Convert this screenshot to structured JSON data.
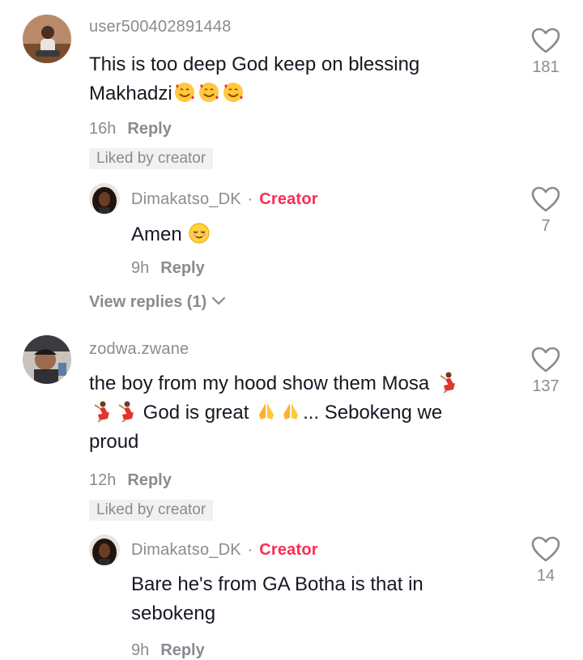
{
  "comments": [
    {
      "username": "user500402891448",
      "text_line1": "This is too deep God keep on blessing",
      "text_line2": "Makhadzi",
      "time": "16h",
      "reply_label": "Reply",
      "liked_label": "Liked by creator",
      "likes": "181",
      "emoji": "smiling-face-with-hearts"
    },
    {
      "username": "Dimakatso_DK",
      "creator_label": "Creator",
      "text": "Amen",
      "time": "9h",
      "reply_label": "Reply",
      "likes": "7",
      "emoji": "relieved-face"
    },
    {
      "view_replies": "View replies (1)"
    },
    {
      "username": "zodwa.zwane",
      "text_line1": "the boy from my hood show them Mosa",
      "text_line2": "God is great",
      "text_line2b": "... Sebokeng we",
      "text_line3": "proud",
      "time": "12h",
      "reply_label": "Reply",
      "liked_label": "Liked by creator",
      "likes": "137",
      "emoji": [
        "woman-dancing",
        "folded-hands"
      ]
    },
    {
      "username": "Dimakatso_DK",
      "creator_label": "Creator",
      "text_line1": "Bare he's from GA Botha is that in",
      "text_line2": "sebokeng",
      "time": "9h",
      "reply_label": "Reply",
      "likes": "14"
    }
  ],
  "icons": {
    "like": "heart-outline-icon",
    "expand": "chevron-down-icon"
  },
  "colors": {
    "creator": "#fe2c55",
    "muted": "#8a8b91",
    "text": "#161823",
    "liked_bg": "#f1f1f2"
  }
}
